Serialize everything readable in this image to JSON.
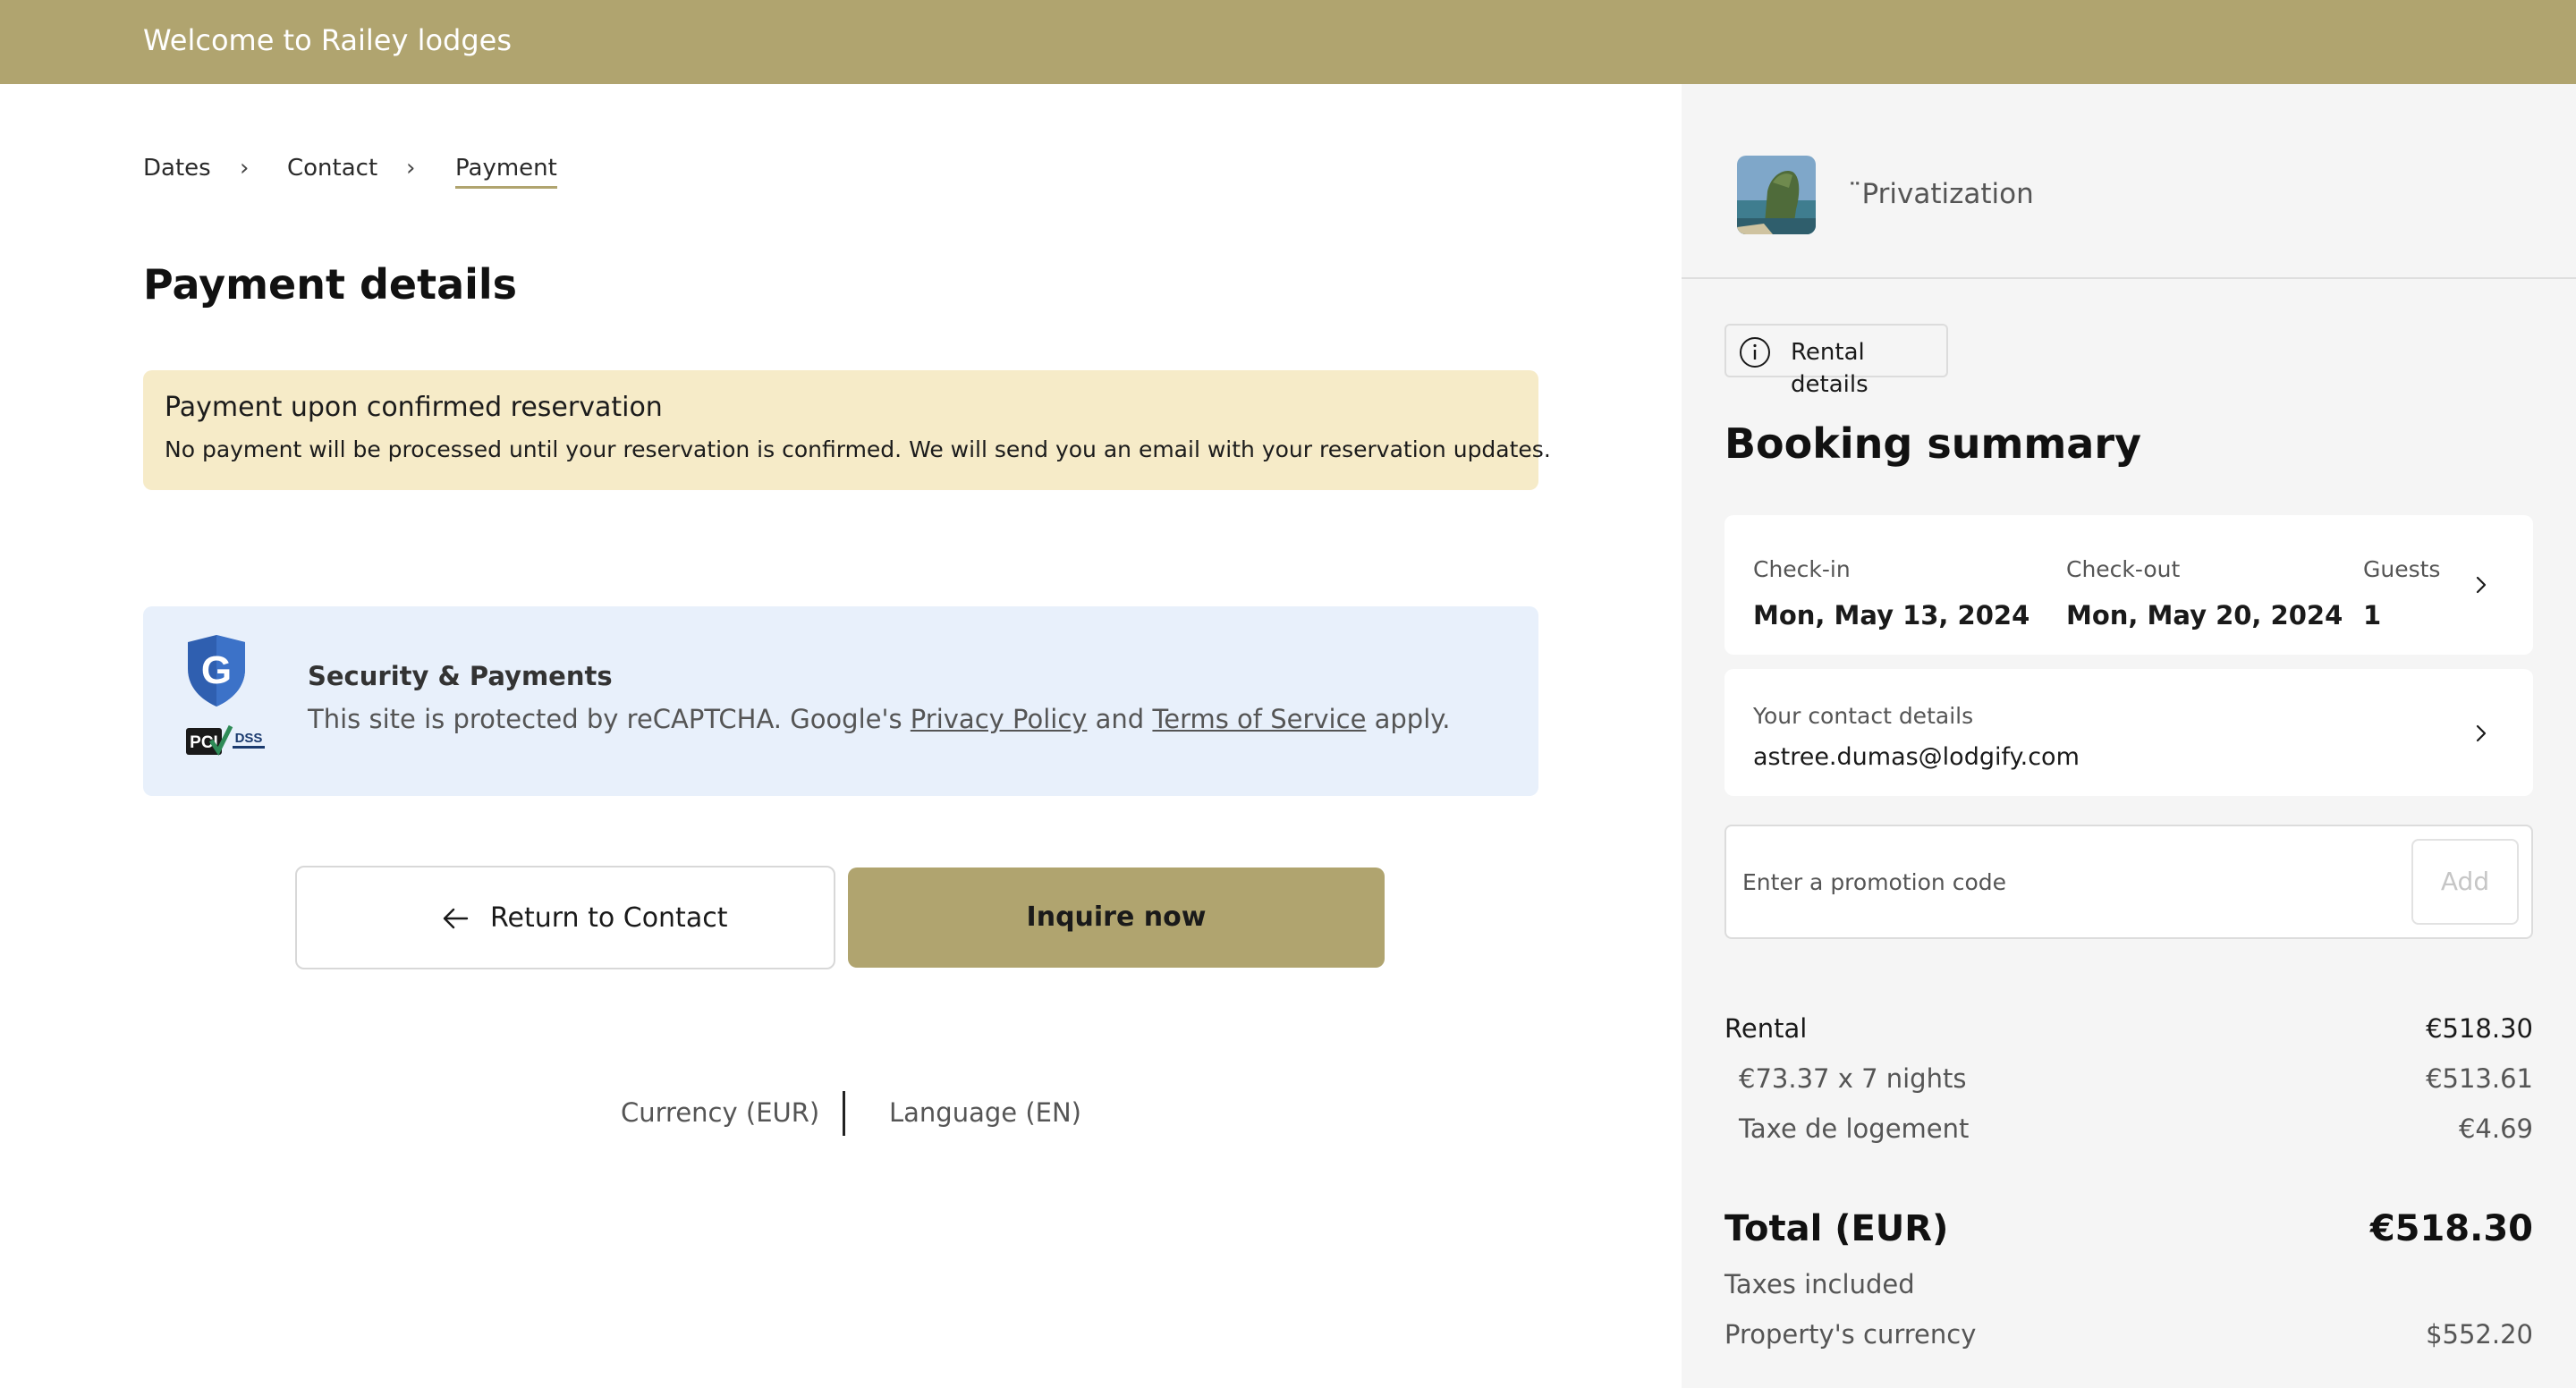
{
  "header": {
    "title": "Welcome to Railey lodges"
  },
  "breadcrumb": {
    "items": [
      {
        "label": "Dates"
      },
      {
        "label": "Contact"
      },
      {
        "label": "Payment"
      }
    ],
    "separator": "›"
  },
  "main": {
    "title": "Payment details",
    "notice": {
      "title": "Payment upon confirmed reservation",
      "text": "No payment will be processed until your reservation is confirmed. We will send you an email with your reservation updates."
    },
    "security": {
      "title": "Security & Payments",
      "text_before": "This site is protected by reCAPTCHA. Google's ",
      "privacy_link": "Privacy Policy",
      "text_middle": " and ",
      "terms_link": "Terms of Service",
      "text_after": " apply.",
      "pci_label": "PCI",
      "dss_label": "DSS"
    },
    "buttons": {
      "return_label": "Return to Contact",
      "inquire_label": "Inquire now"
    },
    "footer": {
      "currency": "Currency (EUR)",
      "language": "Language (EN)"
    }
  },
  "sidebar": {
    "property_name": "¨Privatization",
    "rental_details_label": "Rental details",
    "summary_title": "Booking summary",
    "dates": {
      "checkin_label": "Check-in",
      "checkin_value": "Mon, May 13, 2024",
      "checkout_label": "Check-out",
      "checkout_value": "Mon, May 20, 2024",
      "guests_label": "Guests",
      "guests_value": "1"
    },
    "contact": {
      "label": "Your contact details",
      "value": "astree.dumas@lodgify.com"
    },
    "promo": {
      "placeholder": "Enter a promotion code",
      "add_label": "Add"
    },
    "prices": {
      "rental_label": "Rental",
      "rental_value": "€518.30",
      "nights_label": "€73.37 x 7 nights",
      "nights_value": "€513.61",
      "tax_label": "Taxe de logement",
      "tax_value": "€4.69",
      "total_label": "Total (EUR)",
      "total_value": "€518.30",
      "taxes_included": "Taxes included",
      "property_currency_label": "Property's currency",
      "property_currency_value": "$552.20"
    }
  },
  "colors": {
    "brand": "#b0a46f",
    "notice_bg": "#f6ebc8",
    "security_bg": "#e8f0fb",
    "sidebar_bg": "#f5f5f5"
  },
  "icons": {
    "breadcrumb_separator": "chevron-right-icon",
    "back": "arrow-left-icon",
    "info": "info-icon",
    "card_chevron": "chevron-right-icon",
    "recaptcha": "google-shield-icon",
    "pci": "pci-dss-badge-icon"
  }
}
